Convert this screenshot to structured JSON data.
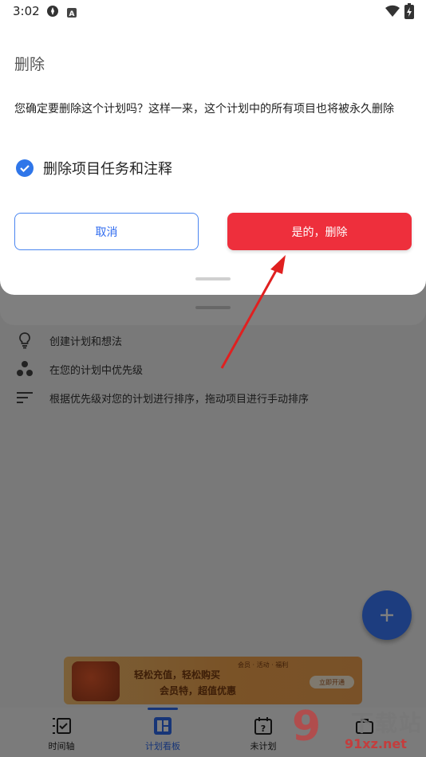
{
  "status_bar": {
    "time": "3:02"
  },
  "dialog": {
    "title": "删除",
    "message": "您确定要删除这个计划吗？这样一来，这个计划中的所有项目也将被永久删除",
    "checkbox_label": "删除项目任务和注释",
    "checkbox_checked": true,
    "cancel_label": "取消",
    "confirm_label": "是的，删除",
    "accent_color": "#2f76e9",
    "danger_color": "#ee2f3c"
  },
  "tips": [
    {
      "icon": "lightbulb-icon",
      "text": "创建计划和想法"
    },
    {
      "icon": "dots-priority-icon",
      "text": "在您的计划中优先级"
    },
    {
      "icon": "sort-lines-icon",
      "text": "根据优先级对您的计划进行排序，拖动项目进行手动排序"
    }
  ],
  "bottom_nav": {
    "items": [
      {
        "icon": "timeline-icon",
        "label": "时间轴"
      },
      {
        "icon": "board-icon",
        "label": "计划看板"
      },
      {
        "icon": "unplanned-icon",
        "label": "未计划"
      }
    ],
    "active_index": 1
  },
  "ad": {
    "line1": "轻松充值，轻松购买",
    "line2": "会员特，超值优惠",
    "small": "会员 · 活动 · 福利",
    "button": "立即开通"
  },
  "watermark": {
    "big": "9",
    "cn": "下载站",
    "url": "91xz.net"
  }
}
